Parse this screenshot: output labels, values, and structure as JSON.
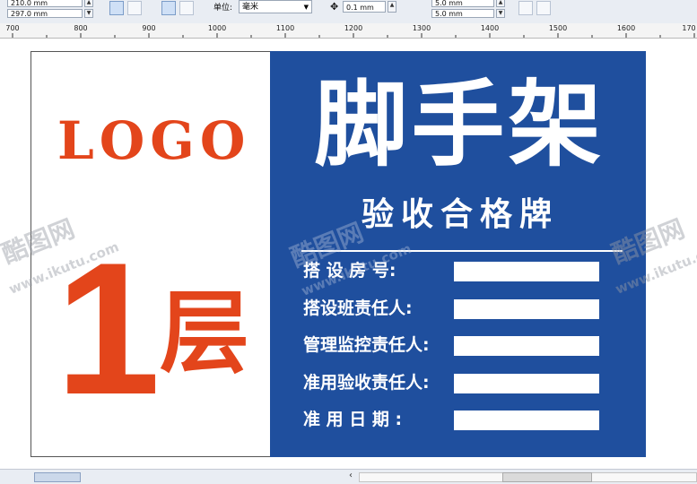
{
  "toolbar": {
    "width_value": "210.0 mm",
    "height_value": "297.0 mm",
    "units_label": "单位:",
    "units_value": "毫米",
    "nudge_value": "0.1 mm",
    "dup_x_value": "5.0 mm",
    "dup_y_value": "5.0 mm"
  },
  "ruler": {
    "ticks": [
      "700",
      "800",
      "900",
      "1000",
      "1100",
      "1200",
      "1300",
      "1400",
      "1500",
      "1600",
      "170"
    ]
  },
  "sign": {
    "logo": "LOGO",
    "floor_number": "1",
    "floor_char": "层",
    "title": "脚手架",
    "subtitle": "验收合格牌",
    "fields": [
      {
        "label": "搭 设 房 号:"
      },
      {
        "label": "搭设班责任人:"
      },
      {
        "label": "管理监控责任人:"
      },
      {
        "label": "准用验收责任人:"
      },
      {
        "label": "准 用 日 期 :"
      }
    ],
    "colors": {
      "panel": "#1f4f9e",
      "accent": "#e3451b"
    }
  },
  "watermark": {
    "brand": "酷图网",
    "url": "www.ikutu.com"
  }
}
